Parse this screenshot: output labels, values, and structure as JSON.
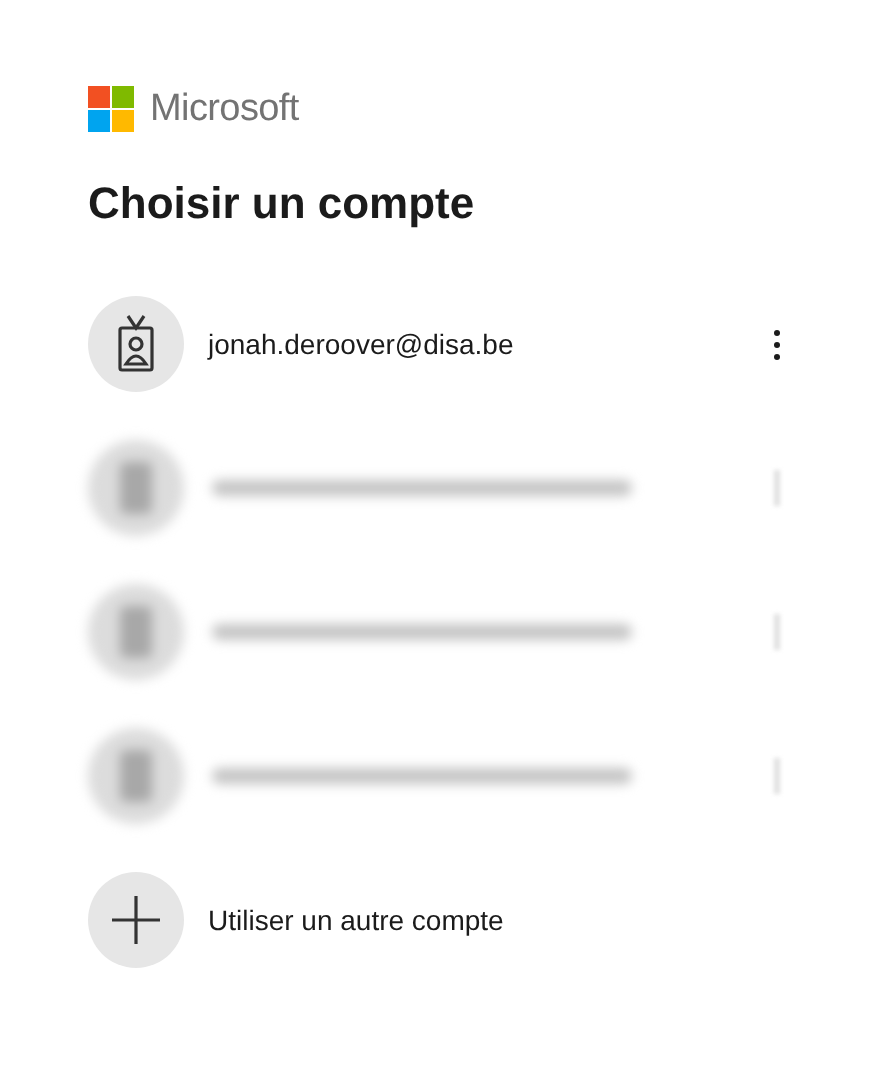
{
  "brand": "Microsoft",
  "title": "Choisir un compte",
  "accounts": [
    {
      "kind": "account",
      "email": "jonah.deroover@disa.be"
    },
    {
      "kind": "blurred"
    },
    {
      "kind": "blurred"
    },
    {
      "kind": "blurred"
    }
  ],
  "other_account": "Utiliser un autre compte"
}
